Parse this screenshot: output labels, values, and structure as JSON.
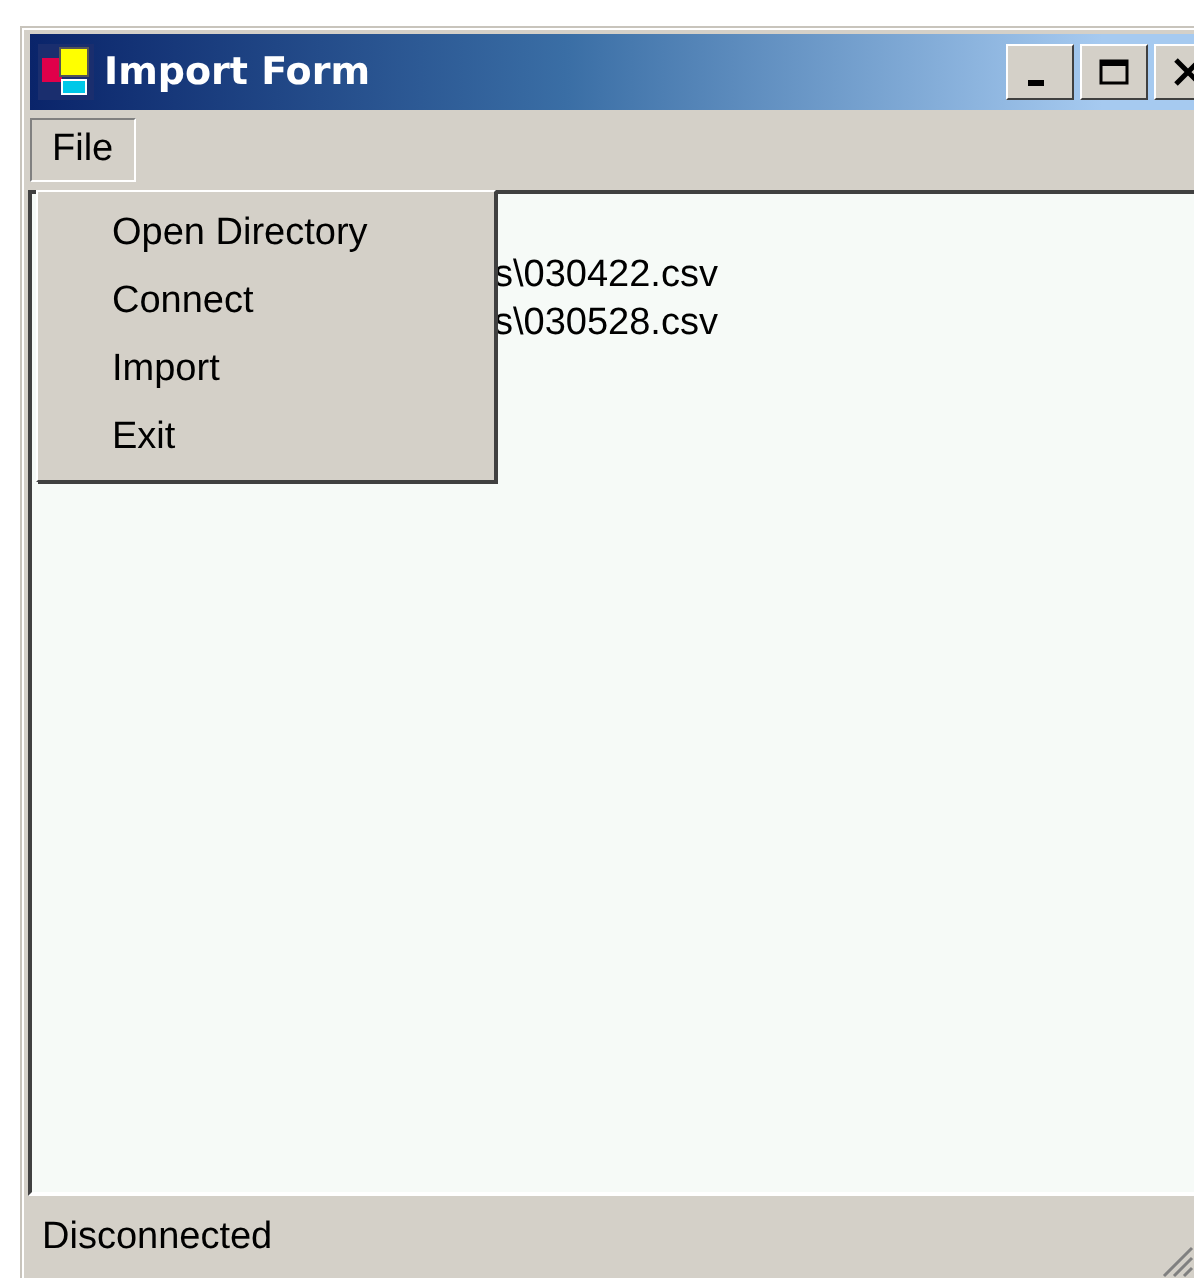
{
  "window": {
    "title": "Import Form"
  },
  "menu_bar": [
    {
      "label": "File",
      "selected": true
    }
  ],
  "menu": {
    "items": [
      "Open Directory",
      "Connect",
      "Import",
      "Exit"
    ]
  },
  "text_area": {
    "lines": [
      "s\\030422.csv",
      "s\\030528.csv"
    ]
  },
  "status_bar": {
    "text": "Disconnected"
  }
}
